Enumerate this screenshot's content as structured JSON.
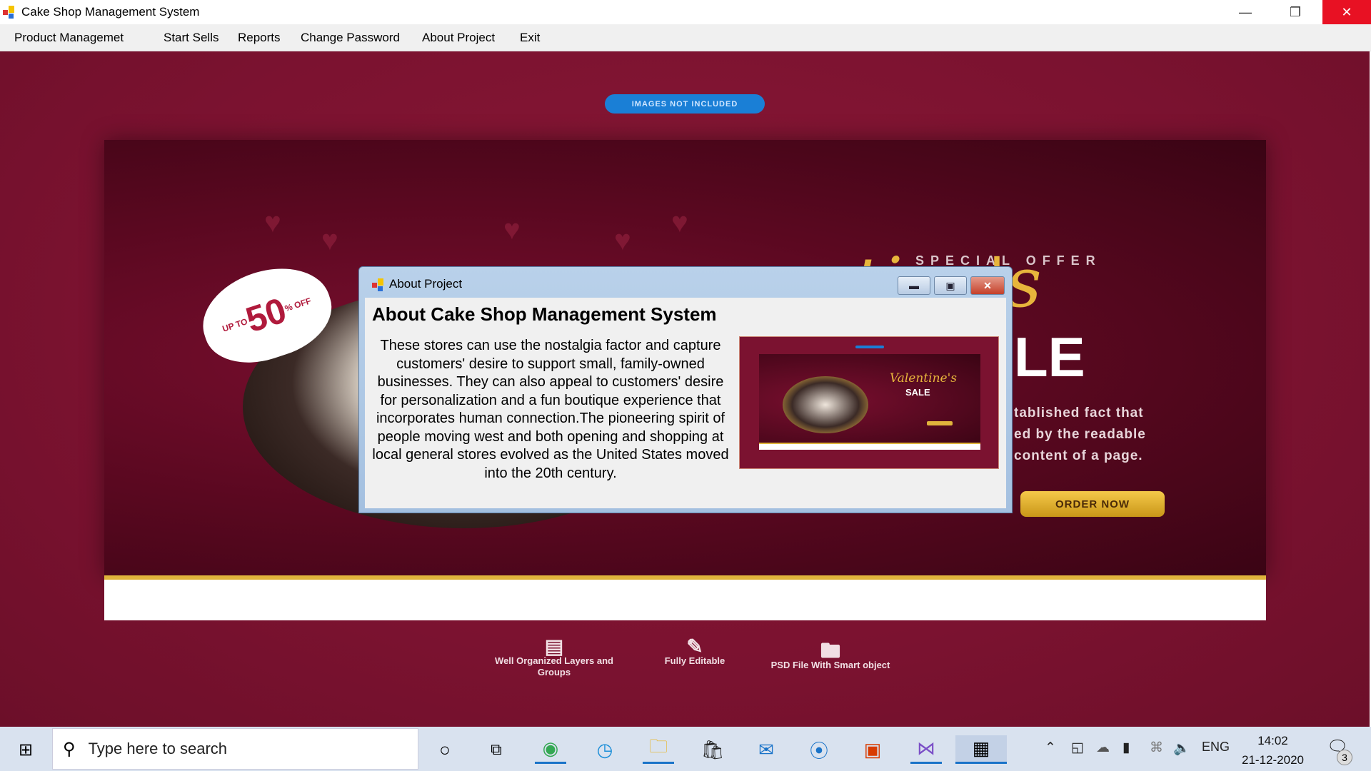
{
  "window": {
    "title": "Cake Shop Management System",
    "icon": "app-icon",
    "controls": [
      "minimize-icon",
      "restore-icon",
      "close-icon"
    ]
  },
  "menu": [
    "Product Managemet",
    "Start Sells",
    "Reports",
    "Change Password",
    "About Project",
    "Exit"
  ],
  "background": {
    "pill": "IMAGES NOT INCLUDED",
    "badge": {
      "small": "UP TO",
      "big": "50",
      "suffix": "% OFF"
    },
    "special": "SPECIAL OFFER",
    "script": "tine's",
    "sale": "LE",
    "para": [
      "tablished fact that",
      "ed by the readable",
      "content of a page."
    ],
    "order": "ORDER NOW",
    "features": [
      {
        "icon": "layers-icon",
        "label": "Well Organized Layers and Groups"
      },
      {
        "icon": "edit-icon",
        "label": "Fully Editable"
      },
      {
        "icon": "folder-icon",
        "label": "PSD File With Smart object"
      }
    ]
  },
  "dialog": {
    "title": "About Project",
    "heading": "About Cake Shop Management System",
    "body": "These stores can use the nostalgia factor and capture customers' desire to support small, family-owned businesses. They can also appeal to customers' desire for personalization and a fun boutique experience that incorporates human connection.The pioneering spirit of people moving west and both opening and shopping at local general stores evolved as the United States moved into the 20th century.",
    "preview": {
      "script": "Valentine's",
      "sale": "SALE"
    }
  },
  "taskbar": {
    "search_placeholder": "Type here to search",
    "apps": [
      "cortana-icon",
      "task-view-icon",
      "chrome-icon",
      "edge-icon",
      "file-explorer-icon",
      "store-icon",
      "mail-icon",
      "app-icon",
      "office-icon",
      "visual-studio-icon",
      "cake-shop-app-icon"
    ],
    "lang": "ENG",
    "time": "14:02",
    "date": "21-12-2020",
    "notifications": "3"
  },
  "colors": {
    "maroon": "#7b1230",
    "gold": "#e7b53c",
    "taskbar": "#d9e2ef",
    "accent": "#1a73c8"
  }
}
